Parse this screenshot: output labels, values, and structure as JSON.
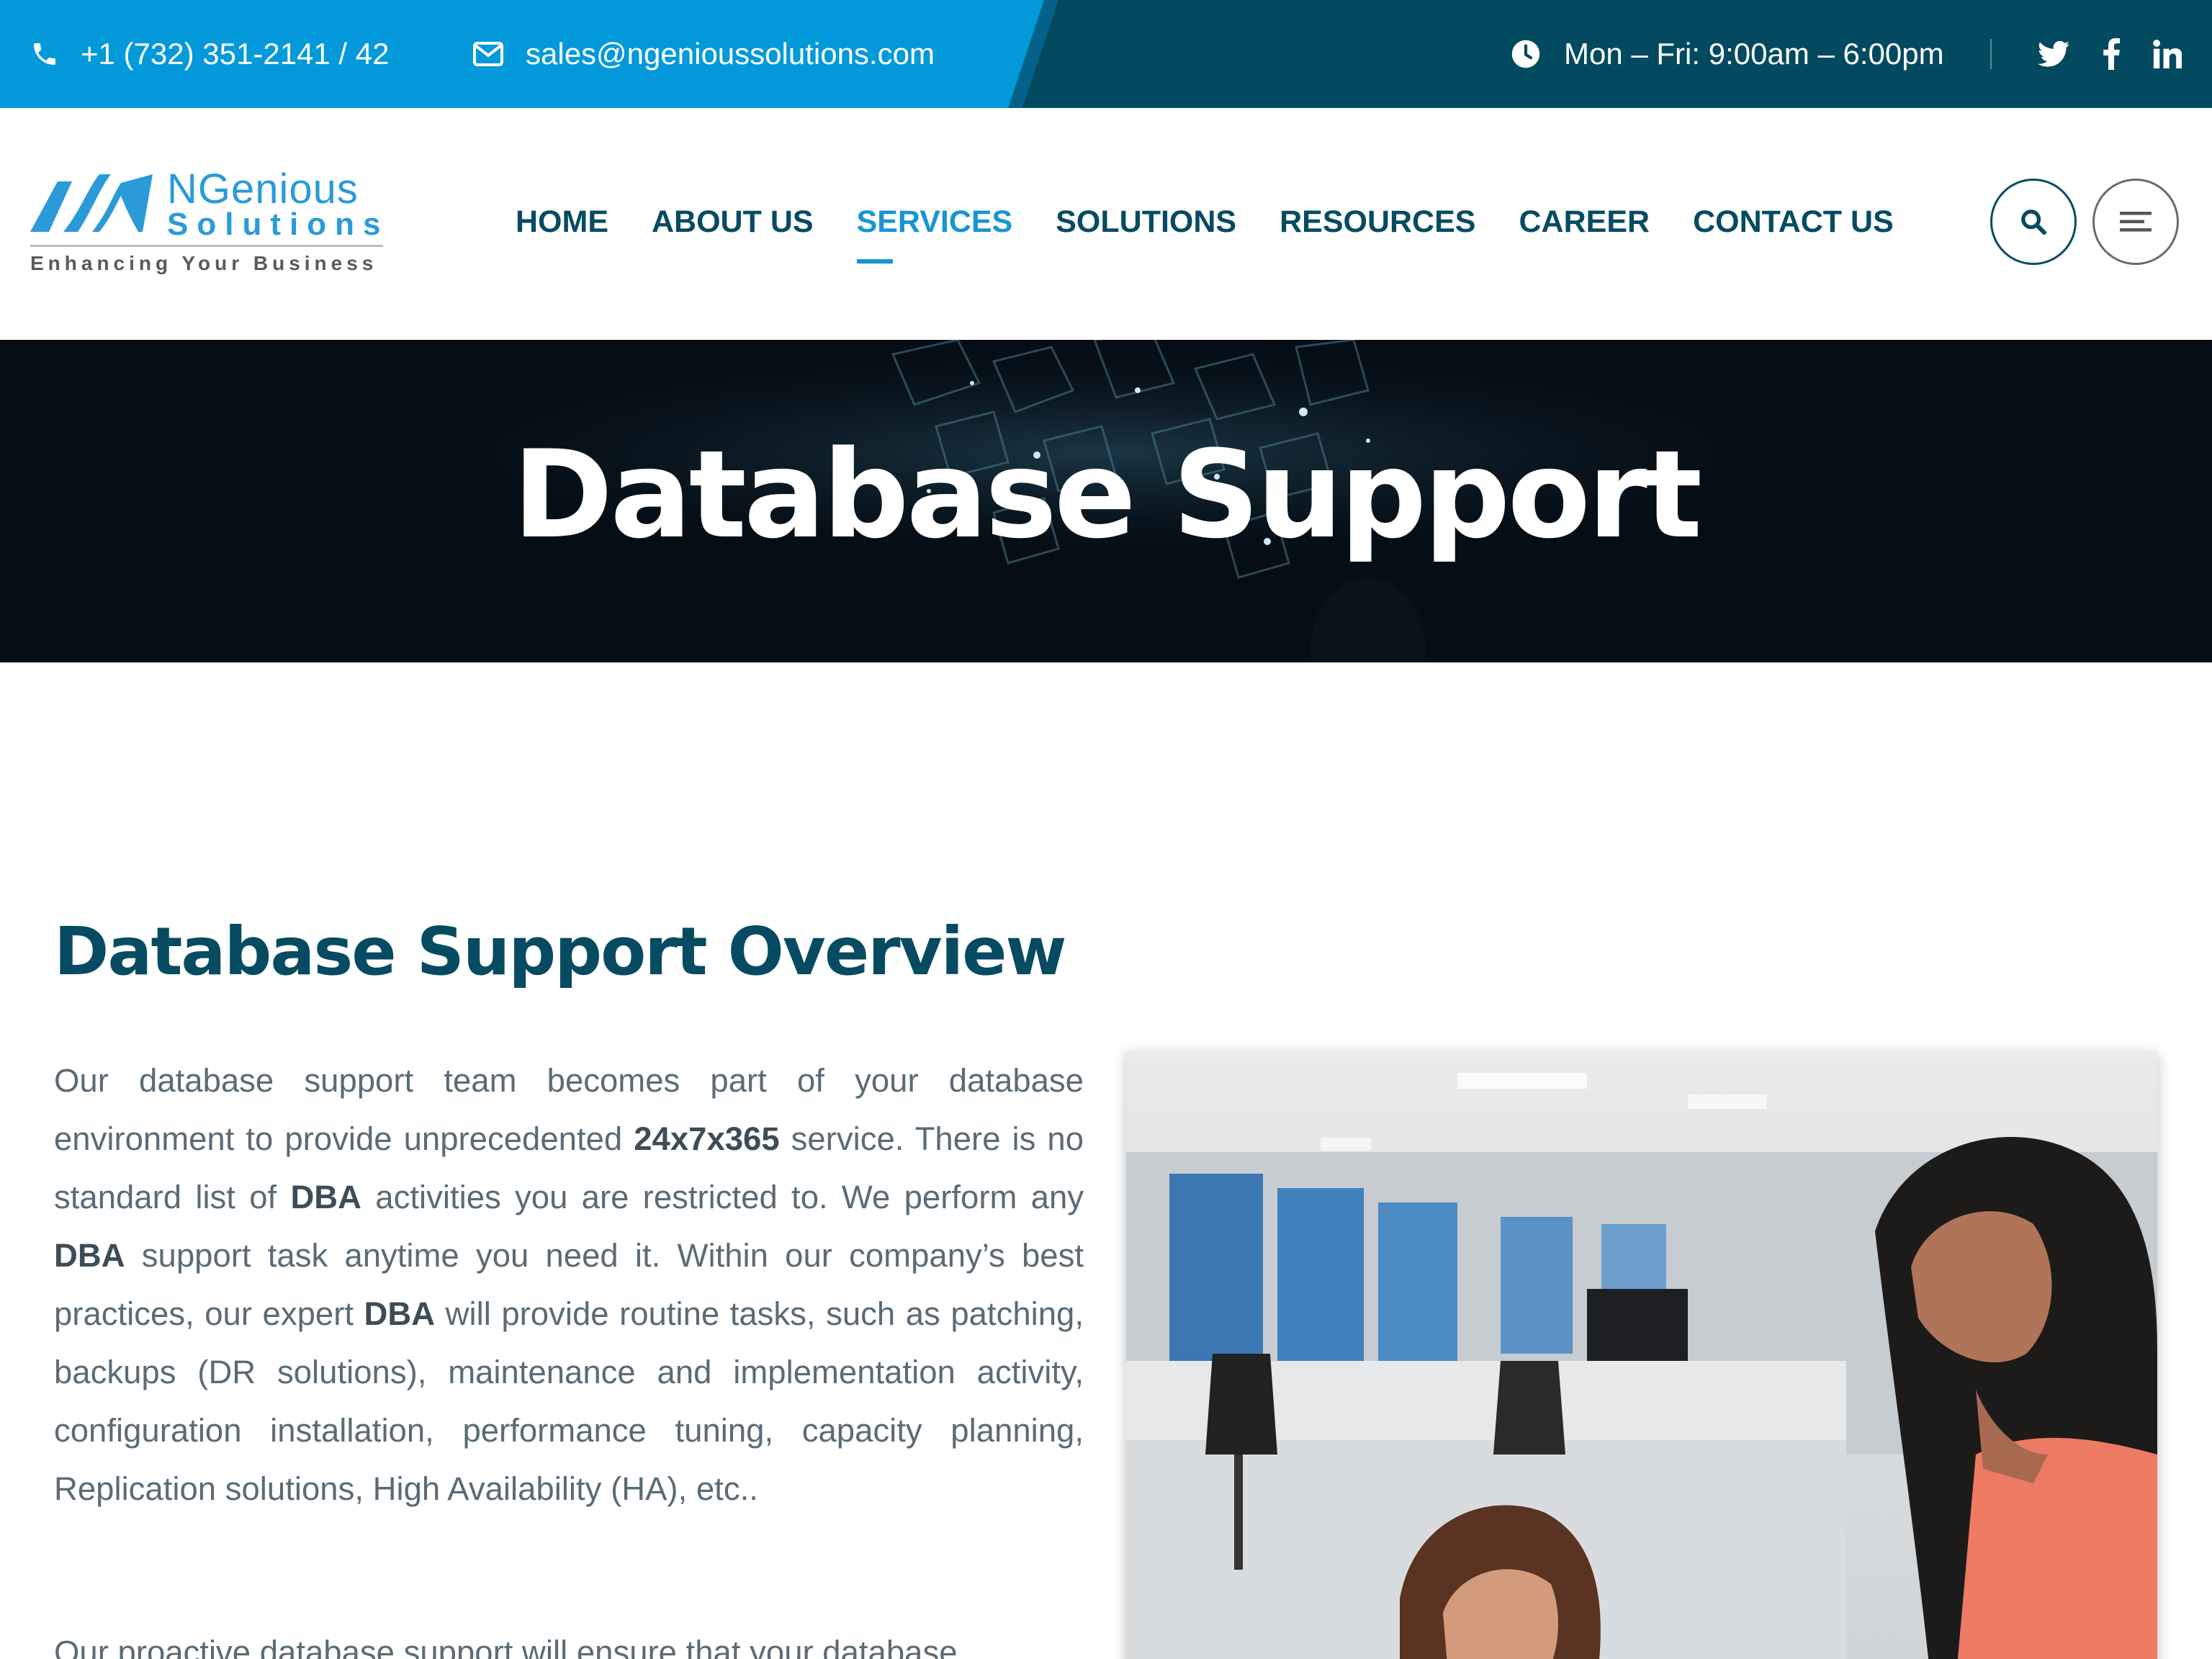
{
  "topbar": {
    "phone": "+1 (732) 351-2141 / 42",
    "email": "sales@ngenioussolutions.com",
    "hours": "Mon – Fri: 9:00am – 6:00pm",
    "social": [
      "twitter-icon",
      "facebook-icon",
      "linkedin-icon"
    ]
  },
  "logo": {
    "line1": "NGenious",
    "line2": "Solutions",
    "tagline": "Enhancing Your Business"
  },
  "nav": {
    "items": [
      {
        "label": "HOME"
      },
      {
        "label": "ABOUT US"
      },
      {
        "label": "SERVICES",
        "active": true
      },
      {
        "label": "SOLUTIONS"
      },
      {
        "label": "RESOURCES"
      },
      {
        "label": "CAREER"
      },
      {
        "label": "CONTACT US"
      }
    ]
  },
  "hero": {
    "title": "Database Support"
  },
  "content": {
    "title": "Database Support Overview",
    "p1": {
      "t1": "Our database support team becomes part of your database environment to provide unprecedented ",
      "b1": "24x7x365",
      "t2": " service. There is no standard list of ",
      "b2": "DBA",
      "t3": " activities you are restricted to. We perform any ",
      "b3": "DBA",
      "t4": " support task anytime you need it. Within our company’s best practices, our expert ",
      "b4": "DBA",
      "t5": " will provide routine tasks, such as patching, backups (DR solutions), maintenance and implementation activity, configuration installation, performance tuning, capacity planning, Replication solutions, High Availability (HA), etc.."
    },
    "p2": "Our proactive database support will ensure that your database"
  },
  "colors": {
    "topbar_dark": "#034a60",
    "topbar_blue": "#0399da",
    "nav_text": "#064b61",
    "nav_active": "#1895d2",
    "body_text": "#5a6b76"
  }
}
